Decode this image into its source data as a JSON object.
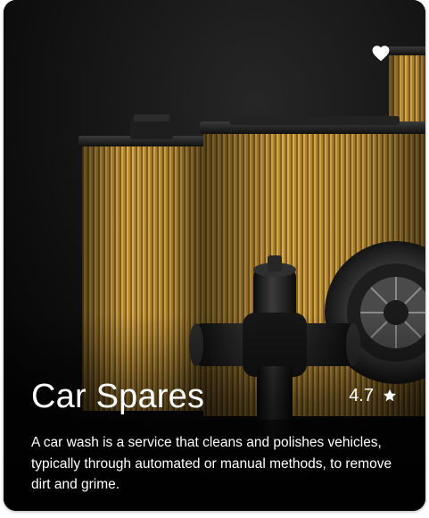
{
  "card": {
    "title": "Car Spares",
    "rating": "4.7",
    "description": "A car wash is a service that cleans and polishes vehicles, typically through automated or manual methods, to remove dirt and grime.",
    "icons": {
      "favorite": "heart-icon",
      "rating": "star-icon"
    },
    "colors": {
      "background": "#0d0d0d",
      "text": "#ffffff",
      "filter_paper": "#c99a35"
    }
  }
}
